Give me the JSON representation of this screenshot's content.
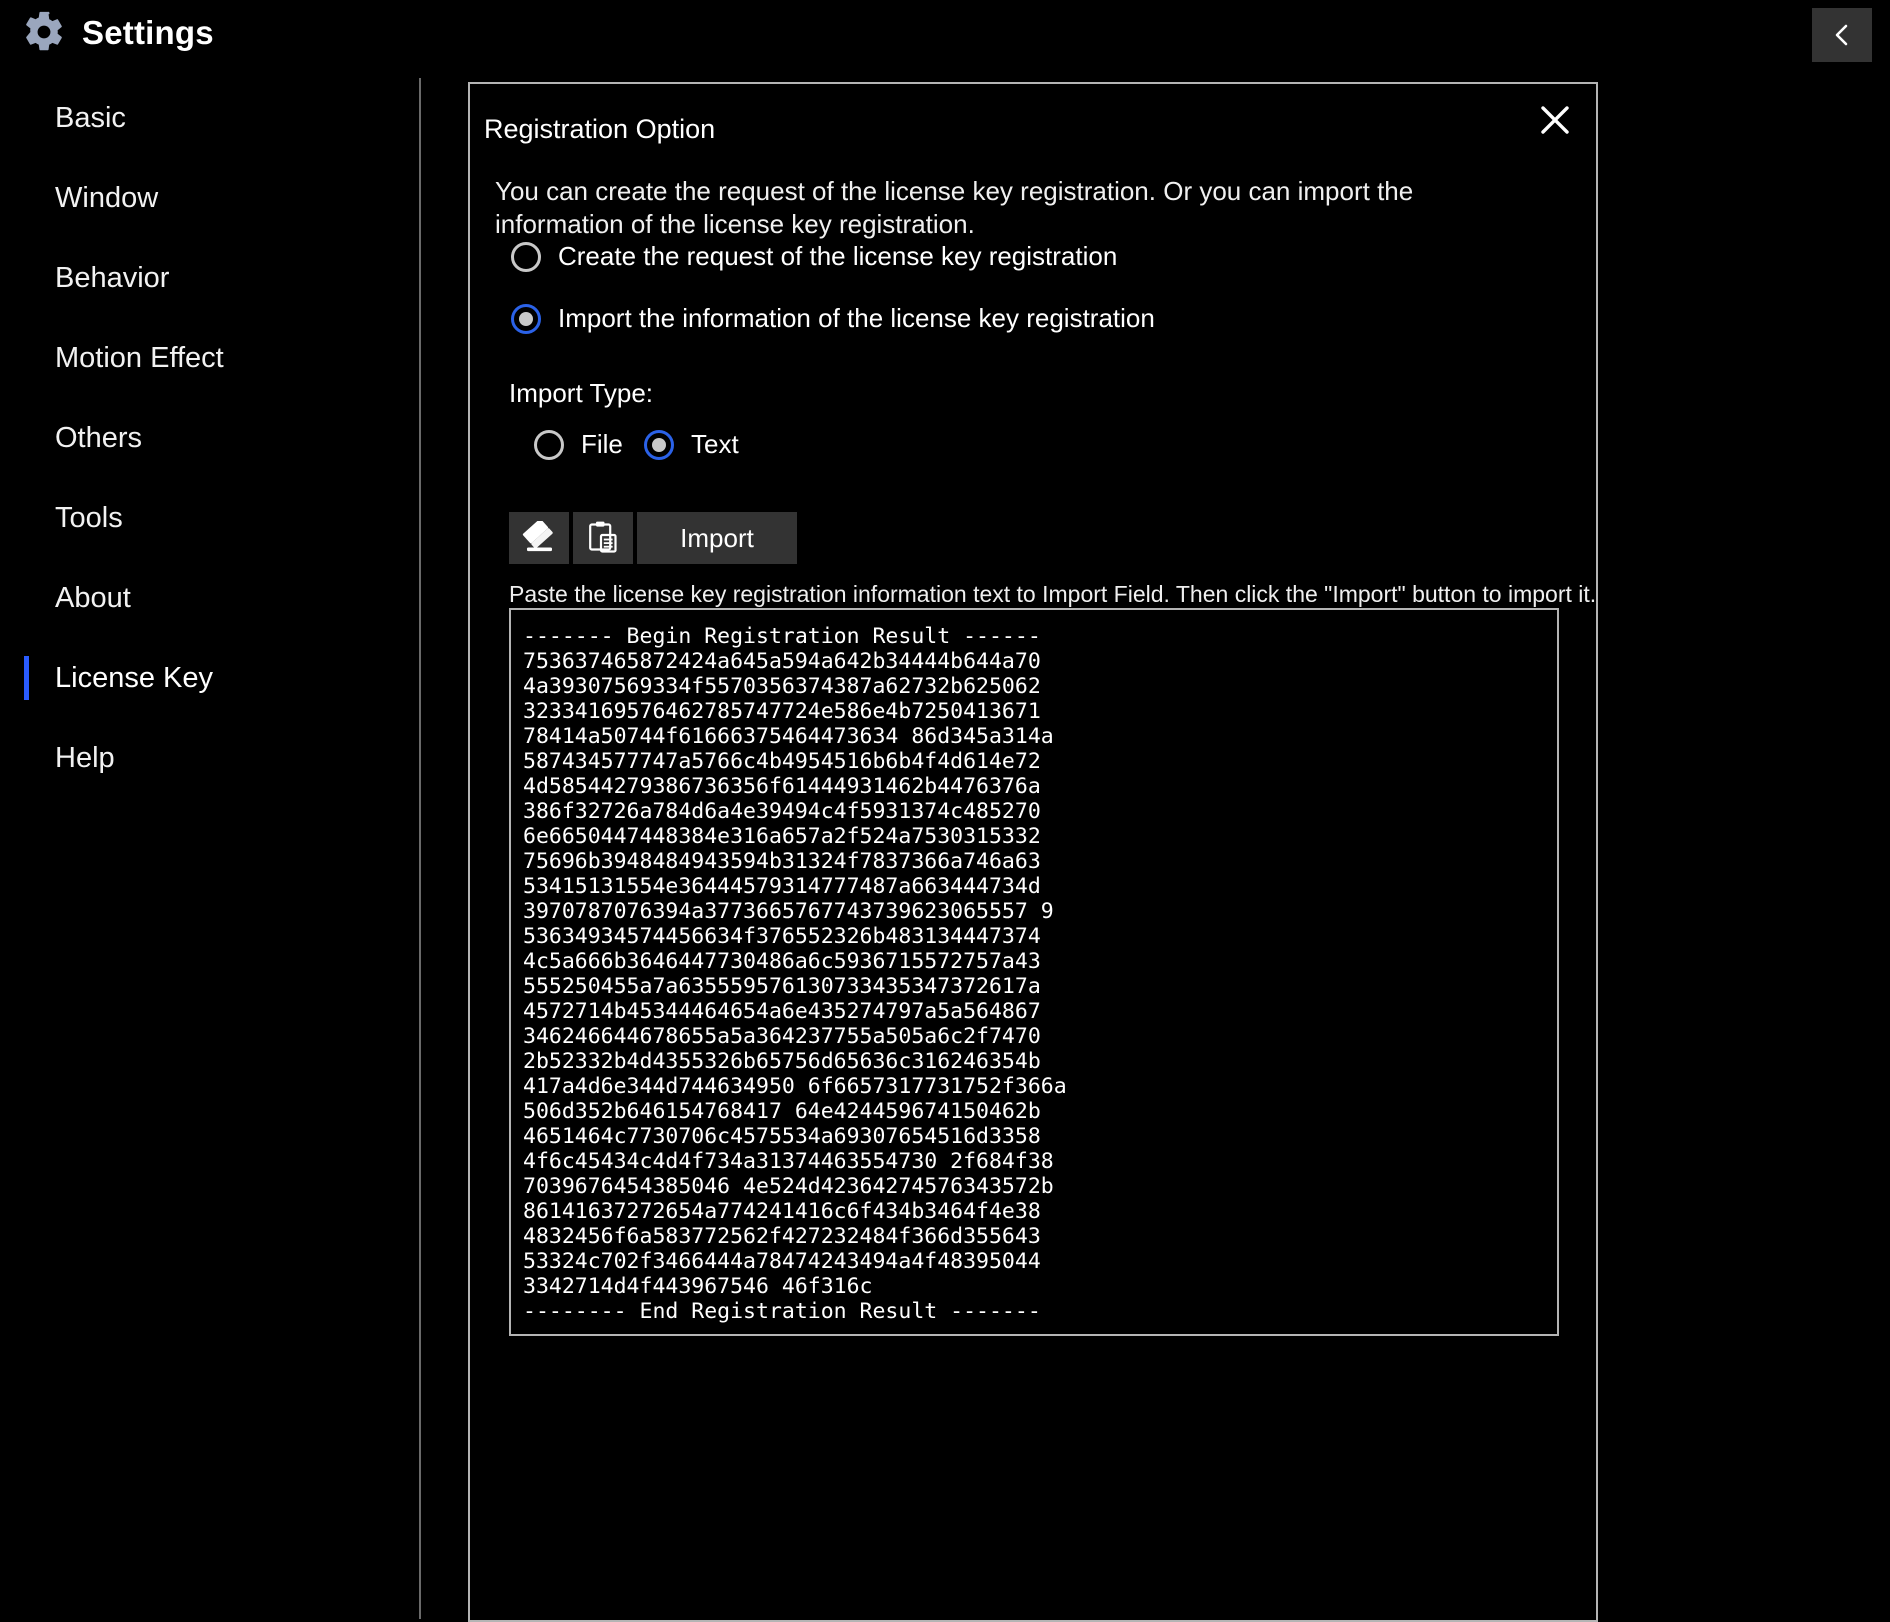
{
  "titlebar": {
    "title": "Settings",
    "gear_icon": "gear-icon",
    "collapse_icon": "chevron-left-icon"
  },
  "sidebar": {
    "items": [
      {
        "label": "Basic",
        "selected": false
      },
      {
        "label": "Window",
        "selected": false
      },
      {
        "label": "Behavior",
        "selected": false
      },
      {
        "label": "Motion Effect",
        "selected": false
      },
      {
        "label": "Others",
        "selected": false
      },
      {
        "label": "Tools",
        "selected": false
      },
      {
        "label": "About",
        "selected": false
      },
      {
        "label": "License Key",
        "selected": true
      },
      {
        "label": "Help",
        "selected": false
      }
    ]
  },
  "dialog": {
    "close_icon": "close-icon",
    "title": "Registration Option",
    "description": "You can create the request of the license key registration. Or you can import the information of the license key registration.",
    "registration_options": [
      {
        "label": "Create the request of the license key registration",
        "checked": false
      },
      {
        "label": "Import the information of the license key registration",
        "checked": true
      }
    ],
    "import_type": {
      "label": "Import Type:",
      "options": [
        {
          "label": "File",
          "checked": false
        },
        {
          "label": "Text",
          "checked": true
        }
      ]
    },
    "toolbar": {
      "clear_icon": "eraser-icon",
      "paste_icon": "clipboard-paste-icon",
      "import_label": "Import"
    },
    "hint": "Paste the license key registration information text to Import Field. Then click the \"Import\" button to import it.",
    "import_field_value": "------- Begin Registration Result ------\n753637465872424a645a594a642b34444b644a70\n4a39307569334f5570356374387a62732b625062\n32334169576462785747724e586e4b7250413671\n78414a50744f61666375464473634 86d345a314a\n587434577747a5766c4b4954516b6b4f4d614e72\n4d58544279386736356f61444931462b4476376a\n386f32726a784d6a4e39494c4f5931374c485270\n6e6650447448384e316a657a2f524a7530315332\n75696b3948484943594b31324f7837366a746a63\n53415131554e36444579314777487a663444734d\n3970787076394a3773665767743739623065557 9\n53634934574456634f376552326b483134447374\n4c5a666b3646447730486a6c5936715572757a43\n555250455a7a635559576130733435347372617a\n4572714b45344464654a6e435274797a5a564867\n346246644678655a5a364237755a505a6c2f7470\n2b52332b4d4355326b65756d65636c316246354b\n417a4d6e344d744634950 6f6657317731752f366a\n506d352b646154768417 64e424459674150462b\n4651464c7730706c4575534a69307654516d3358\n4f6c45434c4d4f734a31374463554730 2f684f38\n7039676454385046 4e524d42364274576343572b\n86141637272654a774241416c6f434b3464f4e38\n4832456f6a583772562f427232484f366d355643\n53324c702f3466444a78474243494a4f48395044\n3342714d4f443967546 46f316c\n-------- End Registration Result -------"
  }
}
